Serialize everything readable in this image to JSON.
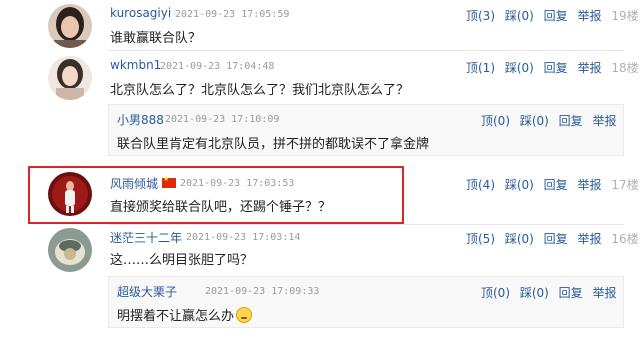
{
  "comments": [
    {
      "user": "kurosagiyi",
      "time": "2021-09-23 17:05:59",
      "text": "谁敢赢联合队？",
      "up": "顶(3)",
      "down": "踩(0)",
      "reply": "回复",
      "report": "举报",
      "floor": "19楼"
    },
    {
      "user": "wkmbn1",
      "time": "2021-09-23 17:04:48",
      "text": "北京队怎么了？北京队怎么了？我们北京队怎么了？",
      "up": "顶(1)",
      "down": "踩(0)",
      "reply": "回复",
      "report": "举报",
      "floor": "18楼",
      "nested": {
        "user": "小男888",
        "time": "2021-09-23 17:10:09",
        "text": "联合队里肯定有北京队员，拼不拼的都耽误不了拿金牌",
        "up": "顶(0)",
        "down": "踩(0)",
        "reply": "回复",
        "report": "举报"
      }
    },
    {
      "user": "风雨倾城",
      "time": "2021-09-23 17:03:53",
      "text": "直接颁奖给联合队吧，还踢个锤子？？",
      "up": "顶(4)",
      "down": "踩(0)",
      "reply": "回复",
      "report": "举报",
      "floor": "17楼"
    },
    {
      "user": "迷茫三十二年",
      "time": "2021-09-23 17:03:14",
      "text": "这……么明目张胆了吗？",
      "up": "顶(5)",
      "down": "踩(0)",
      "reply": "回复",
      "report": "举报",
      "floor": "16楼",
      "nested": {
        "user": "超级大栗子",
        "time": "2021-09-23 17:09:33",
        "text": "明摆着不让赢怎么办",
        "up": "顶(0)",
        "down": "踩(0)",
        "reply": "回复",
        "report": "举报"
      }
    }
  ],
  "colors": {
    "link": "#2b5a9a",
    "highlight": "#d9262a",
    "floor": "#b0b0b0"
  }
}
